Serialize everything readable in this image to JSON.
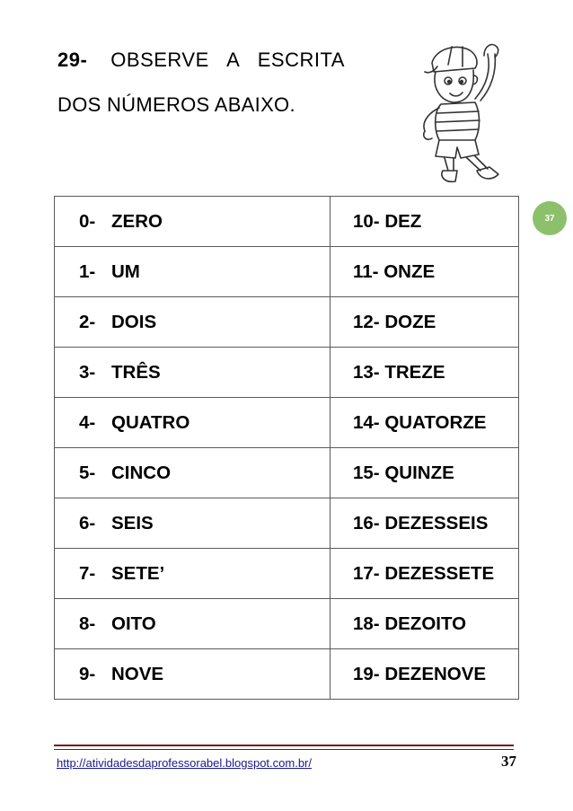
{
  "heading": {
    "number": "29-",
    "line1": "OBSERVE A ESCRITA",
    "line2": "DOS NÚMEROS ABAIXO."
  },
  "page_badge": "37",
  "rows": [
    {
      "left_num": "0-",
      "left_word": "ZERO",
      "right": "10- DEZ"
    },
    {
      "left_num": "1-",
      "left_word": "UM",
      "right": "11-  ONZE"
    },
    {
      "left_num": "2-",
      "left_word": "DOIS",
      "right": "12- DOZE"
    },
    {
      "left_num": "3-",
      "left_word": "TRÊS",
      "right": "13- TREZE"
    },
    {
      "left_num": "4-",
      "left_word": "QUATRO",
      "right": "14- QUATORZE"
    },
    {
      "left_num": "5-",
      "left_word": "CINCO",
      "right": "15- QUINZE"
    },
    {
      "left_num": "6-",
      "left_word": "SEIS",
      "right": "16- DEZESSEIS"
    },
    {
      "left_num": "7-",
      "left_word": "SETE’",
      "right": "17- DEZESSETE"
    },
    {
      "left_num": "8-",
      "left_word": "OITO",
      "right": "18- DEZOITO"
    },
    {
      "left_num": "9-",
      "left_word": "NOVE",
      "right": "19- DEZENOVE"
    }
  ],
  "footer": {
    "url": "http://atividadesdaprofessorabel.blogspot.com.br/",
    "page": "37"
  },
  "colors": {
    "badge": "#8dc06b",
    "footer_rule": "#7a1414",
    "link": "#1a1a8c"
  }
}
